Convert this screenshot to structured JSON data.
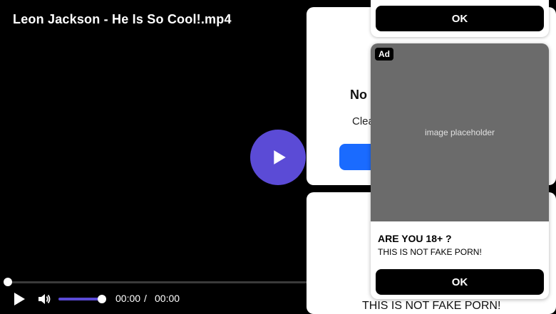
{
  "video": {
    "title": "Leon Jackson - He Is So Cool!.mp4",
    "current_time": "00:00",
    "separator": "/",
    "total_time": "00:00",
    "progress": 0,
    "volume": 1.0,
    "accent_color": "#5b4bd6"
  },
  "card_top": {
    "title_partial": "No",
    "text_partial": "Clea",
    "button_color": "#1a6bff"
  },
  "card_bottom": {
    "text": "THIS IS NOT FAKE PORN!"
  },
  "ad_top": {
    "button_label": "OK"
  },
  "ad_main": {
    "badge": "Ad",
    "heading": "ARE YOU 18+ ?",
    "subtext": "THIS IS NOT FAKE PORN!",
    "button_label": "OK",
    "image_note": "image placeholder"
  },
  "icons": {
    "big_play": "play-icon",
    "control_play": "play-icon",
    "volume": "volume-icon"
  }
}
